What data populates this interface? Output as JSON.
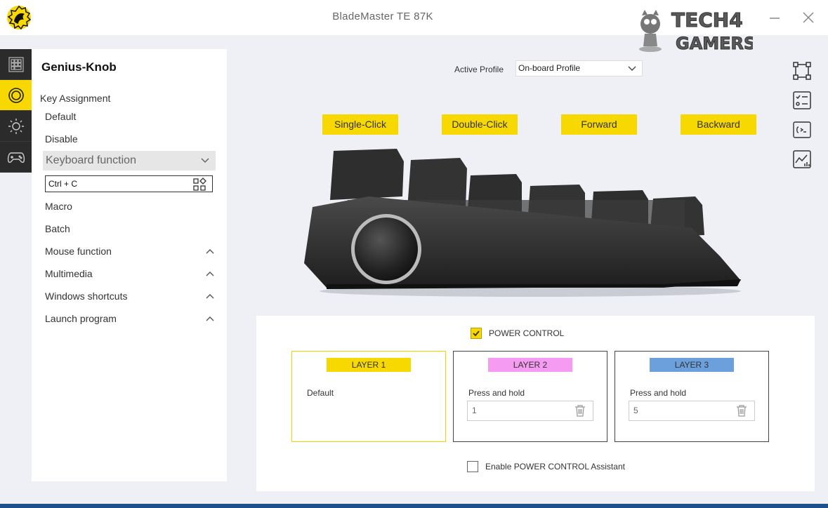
{
  "window": {
    "title": "BladeMaster TE 87K",
    "watermark_line1": "TECH4",
    "watermark_line2": "GAMERS"
  },
  "colors": {
    "accent": "#f7d800",
    "rail_bg": "#2b2b2b",
    "layer2": "#f59cf2",
    "layer3": "#6ca0dc"
  },
  "rail": {
    "items": [
      {
        "icon": "keyboard-grid-icon"
      },
      {
        "icon": "knob-icon",
        "active": true
      },
      {
        "icon": "lighting-sun-icon"
      },
      {
        "icon": "gamepad-icon"
      }
    ]
  },
  "panel": {
    "title": "Genius-Knob",
    "section_label": "Key Assignment",
    "options": {
      "default": "Default",
      "disable": "Disable",
      "keyboard_function": "Keyboard function",
      "macro": "Macro",
      "batch": "Batch",
      "mouse_function": "Mouse function",
      "multimedia": "Multimedia",
      "windows_shortcuts": "Windows shortcuts",
      "launch_program": "Launch program"
    },
    "key_input_value": "Ctrl + C"
  },
  "profile": {
    "label": "Active Profile",
    "selected": "On-board Profile"
  },
  "actions": {
    "single_click": "Single-Click",
    "double_click": "Double-Click",
    "forward": "Forward",
    "backward": "Backward"
  },
  "power_control": {
    "label": "POWER CONTROL",
    "checked": true,
    "layers": [
      {
        "tag": "LAYER 1",
        "text": "Default"
      },
      {
        "tag": "LAYER 2",
        "text": "Press and hold",
        "value": "1"
      },
      {
        "tag": "LAYER 3",
        "text": "Press and hold",
        "value": "5"
      }
    ],
    "assistant_label": "Enable POWER CONTROL Assistant",
    "assistant_checked": false
  }
}
